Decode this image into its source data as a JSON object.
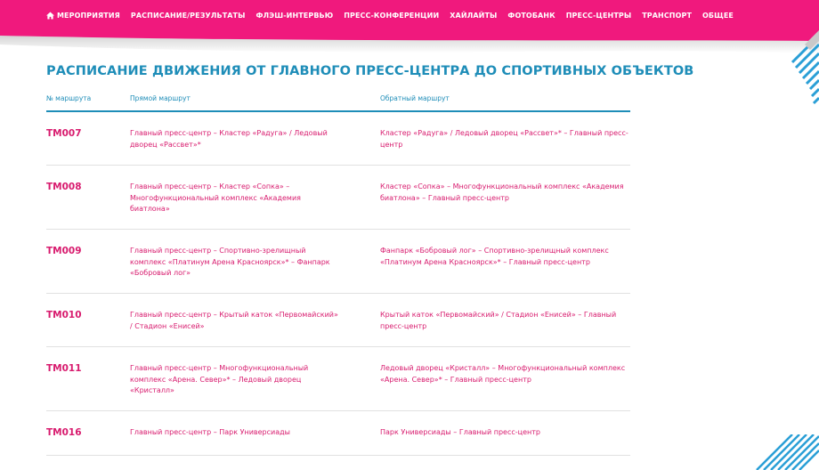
{
  "nav": {
    "items": [
      {
        "label": "МЕРОПРИЯТИЯ",
        "icon": "home-icon"
      },
      {
        "label": "РАСПИСАНИЕ/РЕЗУЛЬТАТЫ"
      },
      {
        "label": "ФЛЭШ-ИНТЕРВЬЮ"
      },
      {
        "label": "ПРЕСС-КОНФЕРЕНЦИИ"
      },
      {
        "label": "ХАЙЛАЙТЫ"
      },
      {
        "label": "ФОТОБАНК"
      },
      {
        "label": "ПРЕСС-ЦЕНТРЫ"
      },
      {
        "label": "ТРАНСПОРТ"
      },
      {
        "label": "ОБЩЕЕ"
      }
    ]
  },
  "page": {
    "title": "РАСПИСАНИЕ ДВИЖЕНИЯ ОТ ГЛАВНОГО ПРЕСС-ЦЕНТРА ДО СПОРТИВНЫХ ОБЪЕКТОВ"
  },
  "table": {
    "headers": {
      "route_no": "№ маршрута",
      "forward": "Прямой маршрут",
      "back": "Обратный маршрут"
    },
    "rows": [
      {
        "code": "ТМ007",
        "forward": [
          "Главный пресс-центр – Кластер «Радуга» / Ледовый",
          "дворец «Рассвет»*"
        ],
        "back": [
          "Кластер «Радуга» / Ледовый дворец «Рассвет»* – Главный пресс-",
          "центр"
        ]
      },
      {
        "code": "ТМ008",
        "forward": [
          "Главный пресс-центр – Кластер «Сопка» –",
          "Многофункциональный комплекс «Академия",
          "биатлона»"
        ],
        "back": [
          "Кластер «Сопка» – Многофункциональный комплекс «Академия",
          "биатлона» – Главный пресс-центр"
        ]
      },
      {
        "code": "ТМ009",
        "forward": [
          "Главный пресс-центр – Спортивно-зрелищный",
          "комплекс «Платинум Арена Красноярск»* – Фанпарк",
          "«Бобровый лог»"
        ],
        "back": [
          "Фанпарк «Бобровый лог» – Спортивно-зрелищный комплекс",
          "«Платинум Арена Красноярск»* – Главный пресс-центр"
        ]
      },
      {
        "code": "ТМ010",
        "forward": [
          "Главный пресс-центр – Крытый каток «Первомайский»",
          "/ Стадион «Енисей»"
        ],
        "back": [
          "Крытый каток «Первомайский» / Стадион «Енисей» – Главный",
          "пресс-центр"
        ]
      },
      {
        "code": "ТМ011",
        "forward": [
          "Главный пресс-центр – Многофункциональный",
          "комплекс «Арена. Север»* – Ледовый дворец",
          "«Кристалл»"
        ],
        "back": [
          "Ледовый дворец «Кристалл» – Многофункциональный комплекс",
          "«Арена. Север»* – Главный пресс-центр"
        ]
      },
      {
        "code": "ТМ016",
        "forward": [
          "Главный пресс-центр – Парк Универсиады"
        ],
        "back": [
          "Парк Универсиады – Главный пресс-центр"
        ]
      }
    ]
  },
  "colors": {
    "brand_magenta": "#f0197d",
    "accent_blue": "#1e8db8",
    "link_pink": "#d81b6e"
  }
}
